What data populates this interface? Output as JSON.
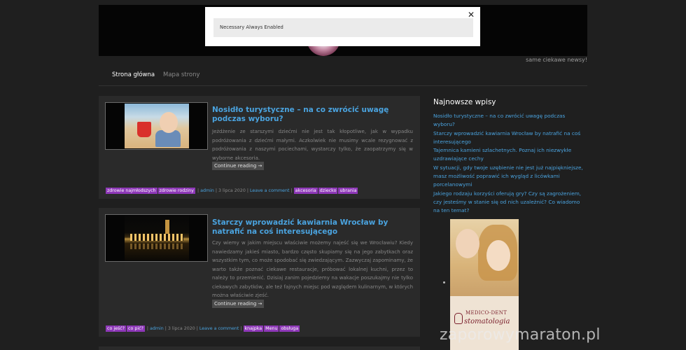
{
  "site": {
    "tagline": "same ciekawe newsy!",
    "watermark": "zaporowymaraton.pl"
  },
  "nav": {
    "items": [
      {
        "label": "Strona główna",
        "active": true
      },
      {
        "label": "Mapa strony",
        "active": false
      }
    ]
  },
  "cookie_banner": {
    "row_text": "Necessary Always Enabled",
    "close_glyph": "✕"
  },
  "posts": [
    {
      "title": "Nosidło turystyczne – na co zwrócić uwagę podczas wyboru?",
      "excerpt": "Jeżdżenie ze starszymi dziećmi nie jest tak kłopotliwe, jak w wypadku podróżowania z dziećmi małymi. Aczkolwiek nie musimy wcale rezygnować z podróżowania z naszymi pociechami, wystarczy tylko, że zaopatrzymy się w wyborne akcesoria.",
      "more": "Continue reading →",
      "categories": [
        "zdrowie najmłodszych",
        "zdrowie rodziny"
      ],
      "author": "admin",
      "date": "3 lipca 2020",
      "comment_link": "Leave a comment",
      "tags": [
        "akcesoria",
        "dziecko",
        "ubrania"
      ],
      "thumb_icon": "beach-child-photo"
    },
    {
      "title": "Starczy wprowadzić kawiarnia Wrocław by natrafić na coś interesującego",
      "excerpt": "Czy wiemy w jakim miejscu właściwie możemy najeść się we Wrocławiu? Kiedy nawiedzamy jakieś miasto, bardzo często skupiamy się na jego zabytkach oraz wszystkim tym, co może spodobać się zwiedzającym. Zazwyczaj zapominamy, że warto także poznać ciekawe restauracje, próbować lokalnej kuchni, przez to należy to przemienić. Dzisiaj zanim pojedziemy na wakacje poszukajmy nie tylko ciekawych zabytków, ale też fajnych miejsc pod względem kulinarnym, w których można właściwie zjeść.",
      "more": "Continue reading →",
      "categories": [
        "co jeść?",
        "co pić?"
      ],
      "author": "admin",
      "date": "3 lipca 2020",
      "comment_link": "Leave a comment",
      "tags": [
        "knajpka",
        "Menu",
        "obsługa"
      ],
      "thumb_icon": "night-city-photo"
    }
  ],
  "sidebar": {
    "title": "Najnowsze wpisy",
    "recent": [
      "Nosidło turystyczne – na co zwrócić uwagę podczas wyboru?",
      "Starczy wprowadzić kawiarnia Wrocław by natrafić na coś interesującego",
      "Tajemnica kamieni szlachetnych. Poznaj ich niezwykłe uzdrawiające cechy",
      "W sytuacji, gdy twoje uzębienie nie jest już najpiękniejsze, masz możliwość poprawić ich wygląd z licówkami porcelanowymi",
      "Jakiego rodzaju korzyści oferują gry? Czy są zagrożeniem, czy jesteśmy w stanie się od nich uzależnić? Co wiadomo na ten temat?"
    ],
    "ad": {
      "brand": "MEDICO-DENT",
      "sub": "stomatologia"
    }
  },
  "colors": {
    "accent_link": "#4aa3df",
    "tag_bg": "#8e38b8",
    "page_bg": "#1f1f1f",
    "post_bg": "#2a2a2a"
  }
}
